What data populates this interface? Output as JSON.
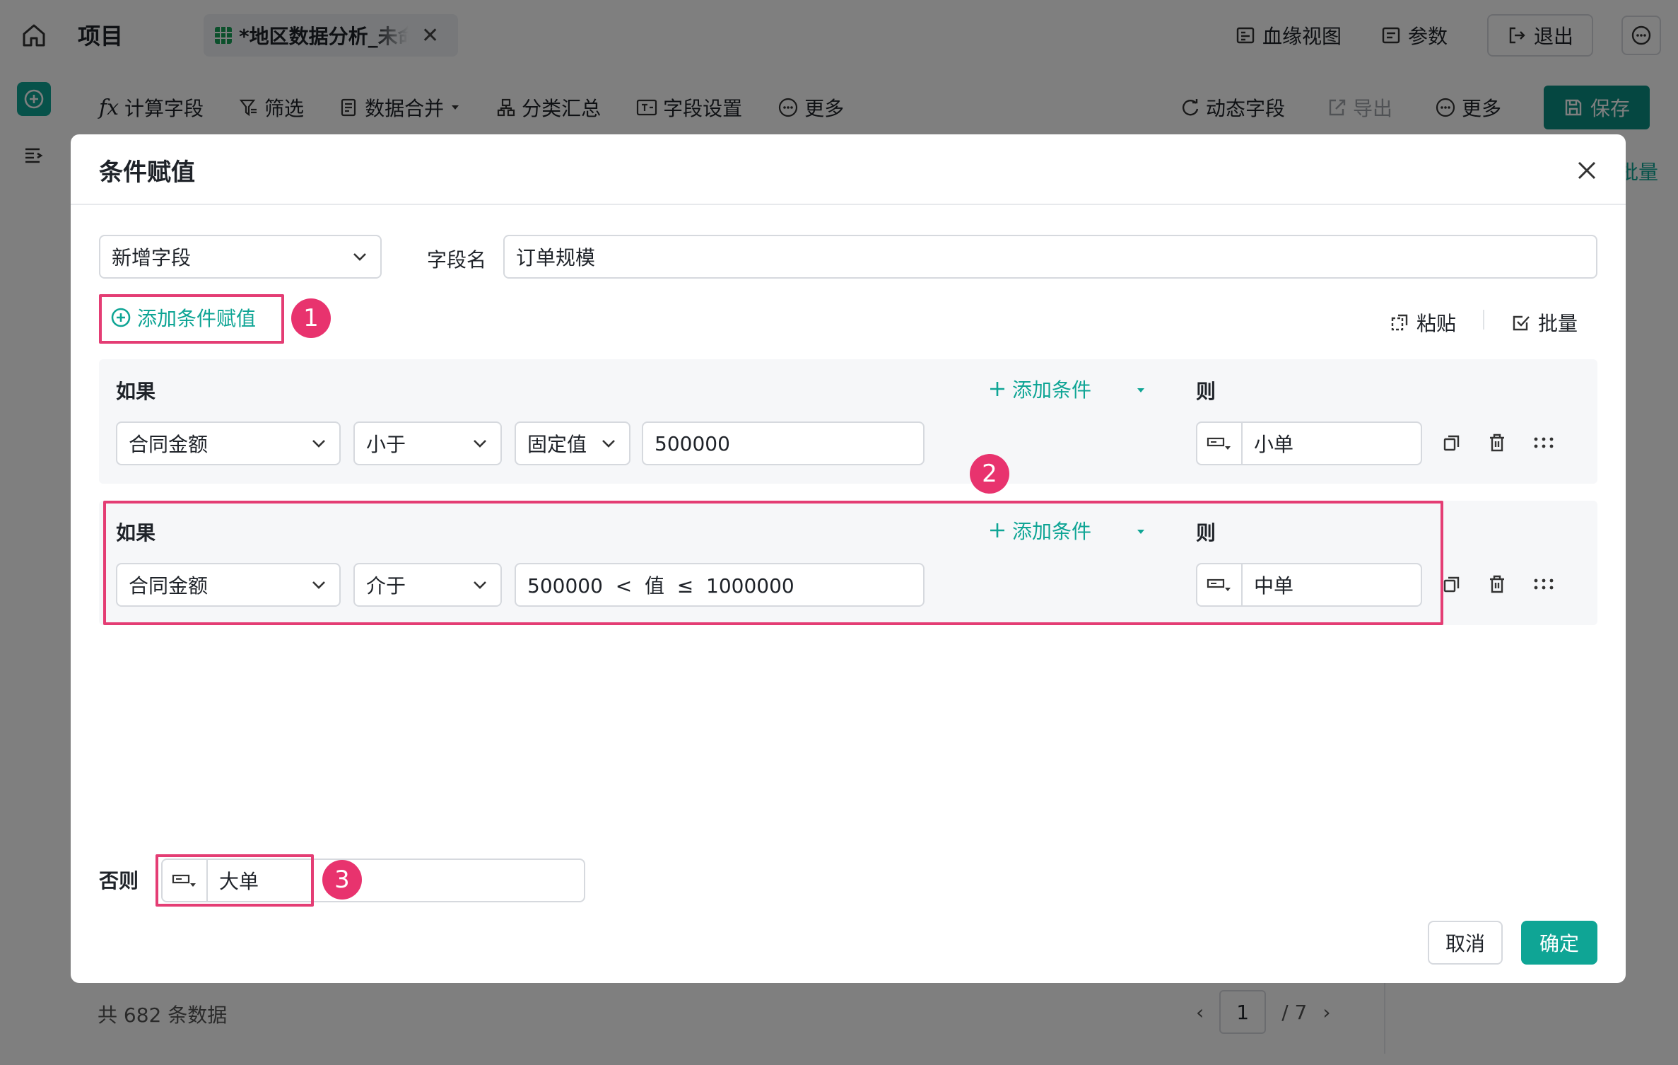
{
  "app": {
    "project_label": "项目",
    "file_tab_name": "*地区数据分析_未命名",
    "header_links": {
      "lineage": "血缘视图",
      "params": "参数",
      "exit": "退出"
    }
  },
  "toolbar": {
    "items": [
      "计算字段",
      "筛选",
      "数据合并",
      "分类汇总",
      "字段设置",
      "更多"
    ],
    "right": {
      "dynamic_field": "动态字段",
      "export": "导出",
      "more": "更多",
      "save": "保存"
    }
  },
  "side_panel": {
    "batch": "批量"
  },
  "footer": {
    "count_text": "共 682 条数据",
    "page_current": "1",
    "page_total": "/ 7"
  },
  "modal": {
    "title": "条件赋值",
    "field_mode": "新增字段",
    "field_name_label": "字段名",
    "field_name_value": "订单规模",
    "add_condition_assign": "添加条件赋值",
    "paste": "粘贴",
    "batch": "批量",
    "conditions": [
      {
        "if_label": "如果",
        "field": "合同金额",
        "operator": "小于",
        "value_type": "固定值",
        "value": "500000",
        "add_condition": "添加条件",
        "then_label": "则",
        "then_value": "小单"
      },
      {
        "if_label": "如果",
        "field": "合同金额",
        "operator": "介于",
        "range_text": "500000  <  值  ≤  1000000",
        "add_condition": "添加条件",
        "then_label": "则",
        "then_value": "中单"
      }
    ],
    "else_label": "否则",
    "else_value": "大单",
    "cancel": "取消",
    "confirm": "确定"
  },
  "annotations": [
    "1",
    "2",
    "3"
  ],
  "colors": {
    "accent": "#0fa595",
    "highlight": "#e43d74",
    "save_bg": "#0b8f82"
  }
}
